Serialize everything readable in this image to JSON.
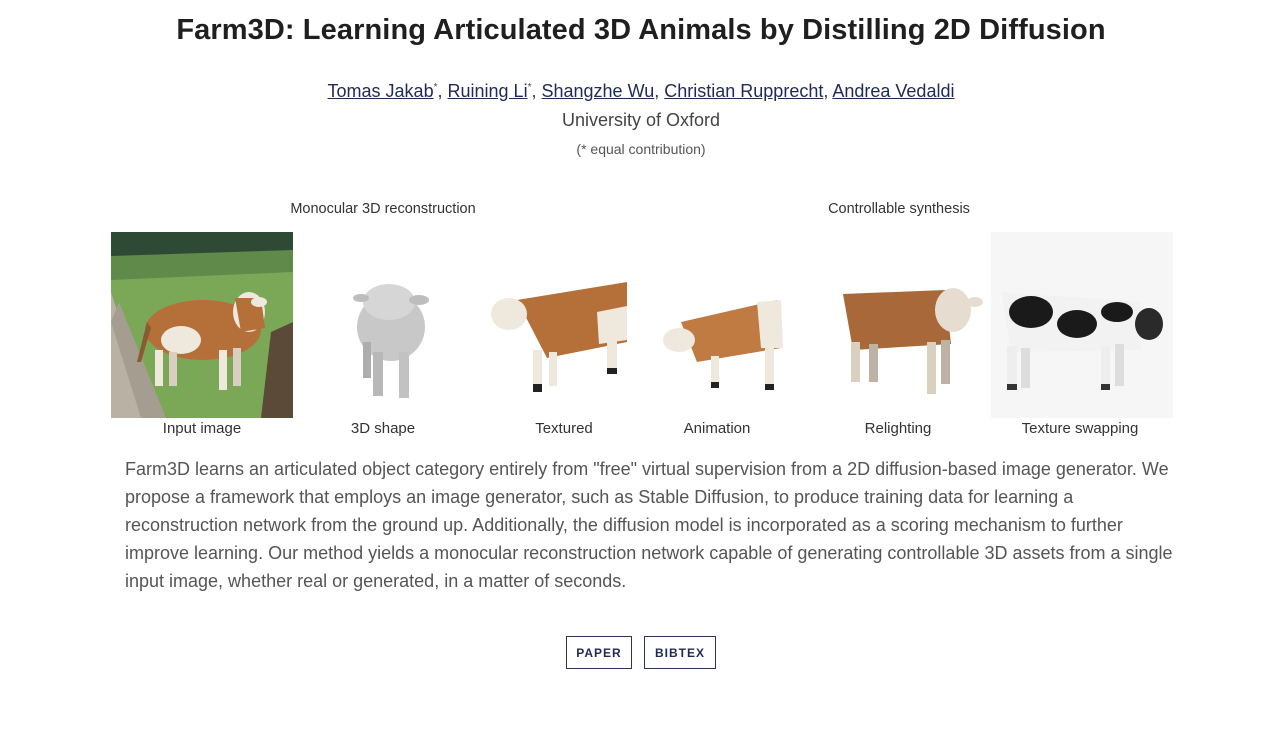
{
  "page": {
    "title": "Farm3D: Learning Articulated 3D Animals by Distilling 2D Diffusion"
  },
  "authors": [
    {
      "name": "Tomas Jakab",
      "mark": "*"
    },
    {
      "name": "Ruining Li",
      "mark": "*"
    },
    {
      "name": "Shangzhe Wu",
      "mark": ""
    },
    {
      "name": "Christian Rupprecht",
      "mark": ""
    },
    {
      "name": "Andrea Vedaldi",
      "mark": ""
    }
  ],
  "separator": ", ",
  "affiliation": "University of Oxford",
  "contribution_note": "(* equal contribution)",
  "figure": {
    "group_labels": {
      "left": "Monocular 3D reconstruction",
      "right": "Controllable synthesis"
    },
    "captions": [
      "Input image",
      "3D shape",
      "Textured",
      "Animation",
      "Relighting",
      "Texture swapping"
    ],
    "colors": {
      "grass": "#6fa04a",
      "sky_trees": "#3a5a3a",
      "cow_brown": "#b5703a",
      "cow_white": "#efe8dc",
      "shape_gray": "#c8c8c8",
      "holstein_black": "#1a1a1a"
    }
  },
  "abstract": "Farm3D learns an articulated object category entirely from \"free\" virtual supervision from a 2D diffusion-based image generator. We propose a framework that employs an image generator, such as Stable Diffusion, to produce training data for learning a reconstruction network from the ground up. Additionally, the diffusion model is incorporated as a scoring mechanism to further improve learning. Our method yields a monocular reconstruction network capable of generating controllable 3D assets from a single input image, whether real or generated, in a matter of seconds.",
  "buttons": {
    "paper": "PAPER",
    "bibtex": "BIBTEX"
  }
}
